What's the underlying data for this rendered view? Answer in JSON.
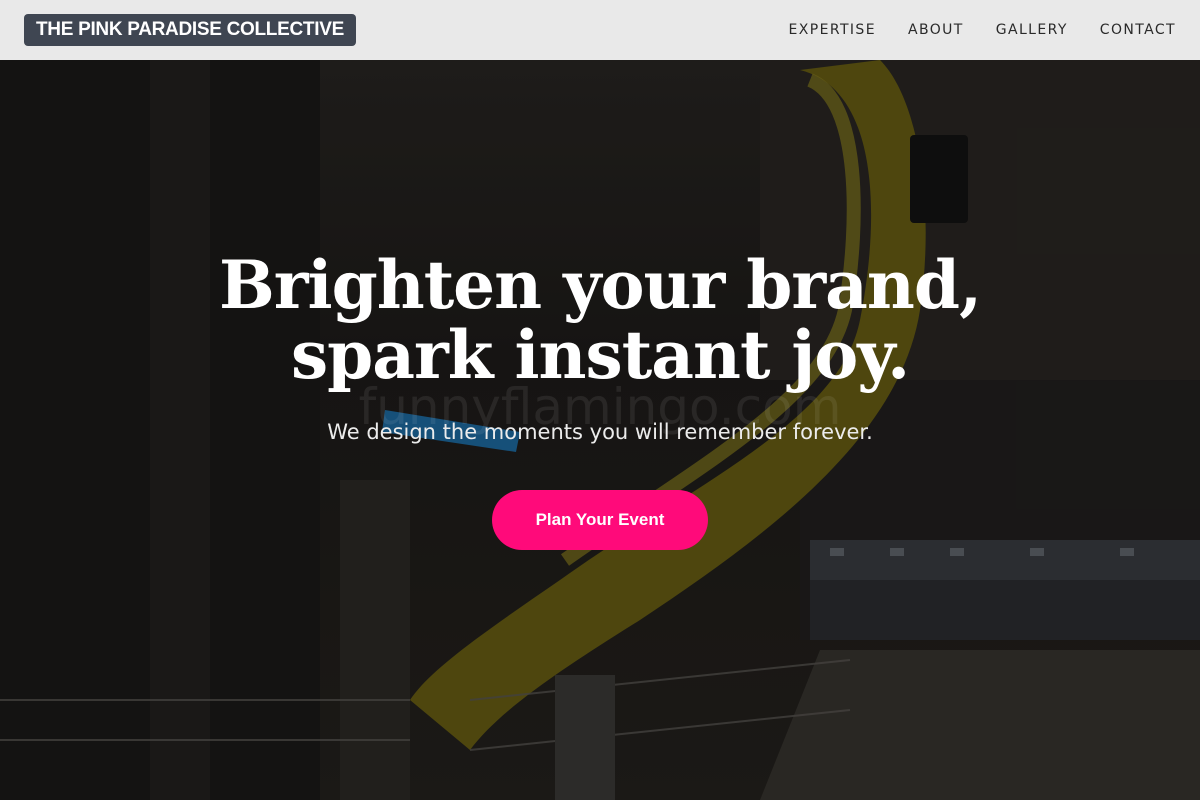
{
  "header": {
    "logo": "THE PINK PARADISE COLLECTIVE",
    "nav": [
      "EXPERTISE",
      "ABOUT",
      "GALLERY",
      "CONTACT"
    ]
  },
  "hero": {
    "headline_line1": "Brighten your brand,",
    "headline_line2": "spark instant joy.",
    "subtitle": "We design the moments you will remember forever.",
    "cta_label": "Plan Your Event",
    "watermark": "funnyflamingo.com"
  },
  "colors": {
    "accent": "#ff0a7a",
    "nav_background": "#e9e9e9",
    "logo_background": "#3f4652"
  }
}
